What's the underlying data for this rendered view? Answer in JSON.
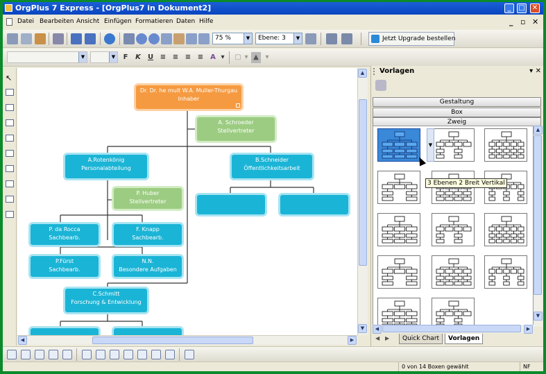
{
  "window": {
    "title": "OrgPlus 7 Express - [OrgPlus7 in Dokument2]",
    "minimize": "_",
    "maximize": "□",
    "close": "✕"
  },
  "menu": {
    "items": [
      "Datei",
      "Bearbeiten",
      "Ansicht",
      "Einfügen",
      "Formatieren",
      "Daten",
      "Hilfe"
    ],
    "mdi_minimize": "_",
    "mdi_restore": "▫",
    "mdi_close": "✕"
  },
  "toolbar": {
    "zoom_value": "75 %",
    "level_value": "Ebene: 3",
    "upgrade_label": "Jetzt Upgrade bestellen"
  },
  "format_toolbar": {
    "font_value": "",
    "size_value": "",
    "bold": "F",
    "italic": "K",
    "underline": "U",
    "font_color": "A"
  },
  "chart": {
    "nodes": [
      {
        "name": "Dr. Dr. he mult W.A. Muller-Thurgau",
        "role": "Inhaber",
        "color": "orange"
      },
      {
        "name": "A. Schroeder",
        "role": "Stellvertreter",
        "color": "green"
      },
      {
        "name": "A.Rotenkönig",
        "role": "Personalabteilung",
        "color": "cyan"
      },
      {
        "name": "B.Schneider",
        "role": "Öffentlichkeitsarbeit",
        "color": "cyan"
      },
      {
        "name": "P. Huber",
        "role": "Stellvertreter",
        "color": "green"
      },
      {
        "name": "",
        "role": "",
        "color": "cyan"
      },
      {
        "name": "",
        "role": "",
        "color": "cyan"
      },
      {
        "name": "P. da Rocca",
        "role": "Sachbearb.",
        "color": "cyan"
      },
      {
        "name": "F. Knapp",
        "role": "Sachbearb.",
        "color": "cyan"
      },
      {
        "name": "P.Fürst",
        "role": "Sachbearb.",
        "color": "cyan"
      },
      {
        "name": "N.N.",
        "role": "Besondere Aufgaben",
        "color": "cyan"
      },
      {
        "name": "C.Schmitt",
        "role": "Forschung & Entwicklung",
        "color": "cyan"
      },
      {
        "name": "",
        "role": "",
        "color": "cyan"
      },
      {
        "name": "",
        "role": "",
        "color": "cyan"
      }
    ]
  },
  "colors": {
    "cyan": "#1ab4d6",
    "green": "#9ccc82",
    "orange": "#f59a40",
    "frame": "#0a8a2a"
  },
  "panel": {
    "title": "Vorlagen",
    "pin": "▾",
    "close": "✕",
    "categories": [
      "Gestaltung",
      "Box",
      "Zweig"
    ],
    "tooltip": "3 Ebenen 2 Breit Vertikal",
    "tabs": [
      "Quick Chart",
      "Vorlagen"
    ]
  },
  "status": {
    "selection": "0 von 14 Boxen gewählt",
    "mode": "NF"
  }
}
